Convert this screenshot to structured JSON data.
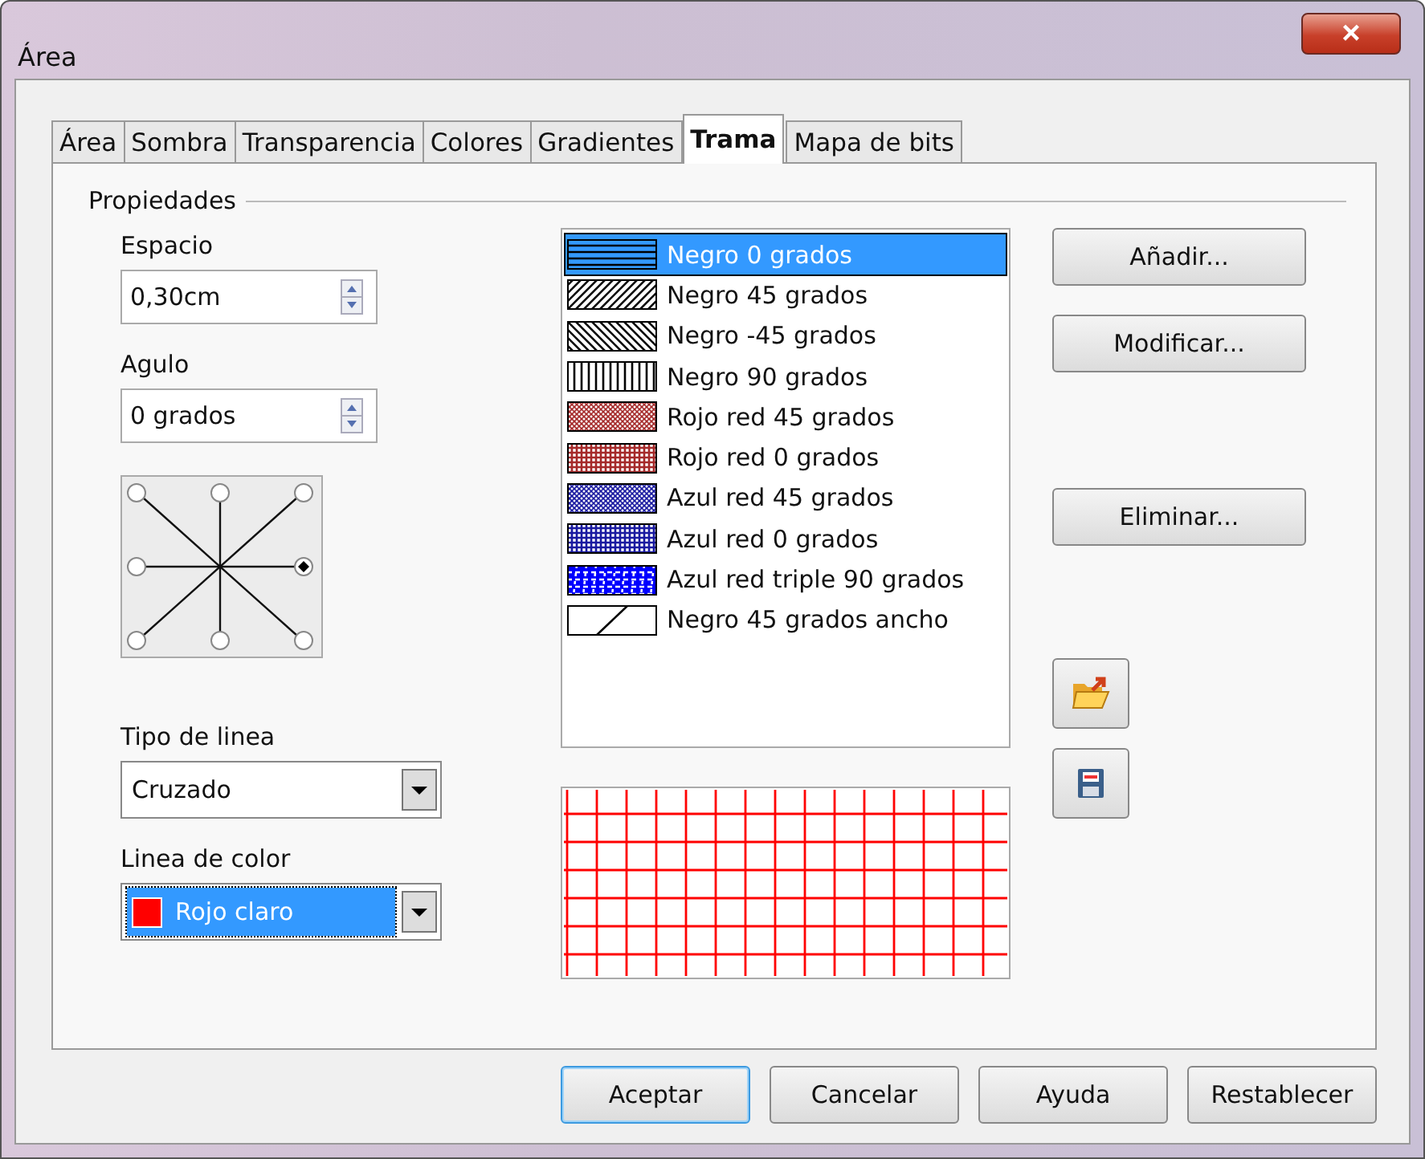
{
  "window": {
    "title": "Área",
    "close": "×"
  },
  "tabs": [
    {
      "label": "Área",
      "selected": false
    },
    {
      "label": "Sombra",
      "selected": false
    },
    {
      "label": "Transparencia",
      "selected": false
    },
    {
      "label": "Colores",
      "selected": false
    },
    {
      "label": "Gradientes",
      "selected": false
    },
    {
      "label": "Trama",
      "selected": true
    },
    {
      "label": "Mapa de bits",
      "selected": false
    }
  ],
  "group_title": "Propiedades",
  "spacing": {
    "label": "Espacio",
    "value": "0,30cm"
  },
  "angle": {
    "label": "Agulo",
    "value": "0 grados"
  },
  "angle_positions": [
    {
      "selected": false
    },
    {
      "selected": false
    },
    {
      "selected": false
    },
    {
      "selected": false
    },
    {
      "selected": true
    },
    {
      "selected": false
    },
    {
      "selected": false
    },
    {
      "selected": false
    }
  ],
  "line_type": {
    "label": "Tipo de linea",
    "value": "Cruzado"
  },
  "line_color": {
    "label": "Linea de color",
    "value": "Rojo claro",
    "color": "#ff0000"
  },
  "hatches": [
    {
      "name": "Negro 0 grados",
      "kind": "h",
      "color": "#000000",
      "selected": true
    },
    {
      "name": "Negro 45 grados",
      "kind": "d45",
      "color": "#000000",
      "selected": false
    },
    {
      "name": "Negro -45 grados",
      "kind": "dm45",
      "color": "#000000",
      "selected": false
    },
    {
      "name": "Negro 90 grados",
      "kind": "v",
      "color": "#000000",
      "selected": false
    },
    {
      "name": "Rojo red 45 grados",
      "kind": "net45",
      "color": "#a52a2a",
      "selected": false
    },
    {
      "name": "Rojo red 0 grados",
      "kind": "net0",
      "color": "#a52a2a",
      "selected": false
    },
    {
      "name": "Azul red 45 grados",
      "kind": "net45",
      "color": "#1a1aa0",
      "selected": false
    },
    {
      "name": "Azul red 0 grados",
      "kind": "net0",
      "color": "#1a1aa0",
      "selected": false
    },
    {
      "name": "Azul red triple 90 grados",
      "kind": "triple",
      "color": "#0000ff",
      "selected": false
    },
    {
      "name": "Negro 45 grados ancho",
      "kind": "wide",
      "color": "#000000",
      "selected": false
    }
  ],
  "side_buttons": [
    "Añadir...",
    "Modificar...",
    "Eliminar..."
  ],
  "footer_buttons": [
    {
      "label": "Aceptar",
      "default": true
    },
    {
      "label": "Cancelar",
      "default": false
    },
    {
      "label": "Ayuda",
      "default": false
    },
    {
      "label": "Restablecer",
      "default": false
    }
  ]
}
